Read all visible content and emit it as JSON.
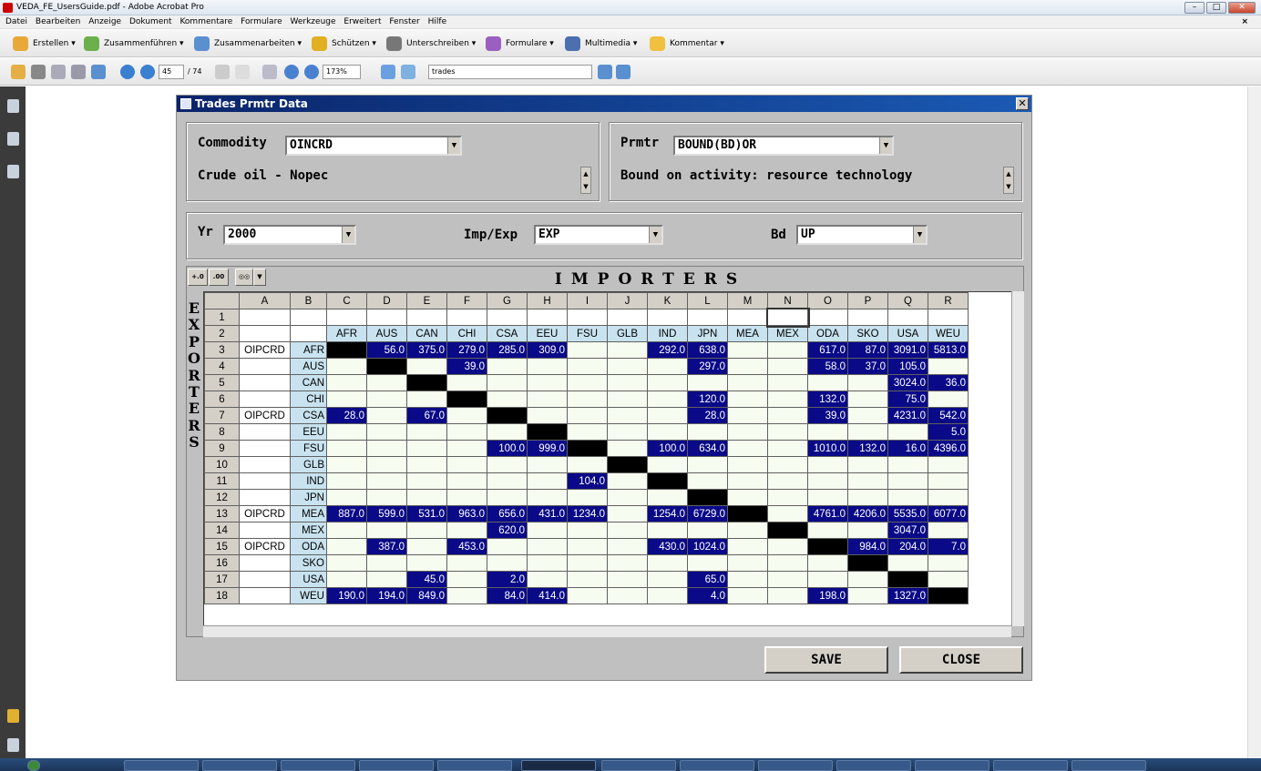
{
  "window": {
    "title": "VEDA_FE_UsersGuide.pdf - Adobe Acrobat Pro"
  },
  "menu": [
    "Datei",
    "Bearbeiten",
    "Anzeige",
    "Dokument",
    "Kommentare",
    "Formulare",
    "Werkzeuge",
    "Erweitert",
    "Fenster",
    "Hilfe"
  ],
  "toolbar1": [
    "Erstellen ▾",
    "Zusammenführen ▾",
    "Zusammenarbeiten ▾",
    "Schützen ▾",
    "Unterschreiben ▾",
    "Formulare ▾",
    "Multimedia ▾",
    "Kommentar ▾"
  ],
  "toolbar2": {
    "page": "45",
    "total": "/ 74",
    "zoom": "173%",
    "search": "trades"
  },
  "dialog": {
    "title": "Trades Prmtr Data",
    "commodity_label": "Commodity",
    "commodity_value": "OINCRD",
    "commodity_desc": "Crude oil - Nopec",
    "prmtr_label": "Prmtr",
    "prmtr_value": "BOUND(BD)OR",
    "prmtr_desc": "Bound on activity: resource technology",
    "yr_label": "Yr",
    "yr_value": "2000",
    "impexp_label": "Imp/Exp",
    "impexp_value": "EXP",
    "bd_label": "Bd",
    "bd_value": "UP",
    "importers_title": "IMPORTERS",
    "exporters_title": "EXPORTERS",
    "save_label": "SAVE",
    "close_label": "CLOSE"
  },
  "grid": {
    "col_letters": [
      "A",
      "B",
      "C",
      "D",
      "E",
      "F",
      "G",
      "H",
      "I",
      "J",
      "K",
      "L",
      "M",
      "N",
      "O",
      "P",
      "Q",
      "R"
    ],
    "regions": [
      "AFR",
      "AUS",
      "CAN",
      "CHI",
      "CSA",
      "EEU",
      "FSU",
      "GLB",
      "IND",
      "JPN",
      "MEA",
      "MEX",
      "ODA",
      "SKO",
      "USA",
      "WEU"
    ],
    "rows": [
      {
        "a": "OIPCRD",
        "b": "AFR",
        "vals": [
          "",
          "56.0",
          "375.0",
          "279.0",
          "285.0",
          "309.0",
          "",
          "",
          "292.0",
          "638.0",
          "",
          "",
          "617.0",
          "87.0",
          "3091.0",
          "5813.0"
        ]
      },
      {
        "a": "",
        "b": "AUS",
        "vals": [
          "",
          "",
          "",
          "39.0",
          "",
          "",
          "",
          "",
          "",
          "297.0",
          "",
          "",
          "58.0",
          "37.0",
          "105.0",
          ""
        ]
      },
      {
        "a": "",
        "b": "CAN",
        "vals": [
          "",
          "",
          "",
          "",
          "",
          "",
          "",
          "",
          "",
          "",
          "",
          "",
          "",
          "",
          "3024.0",
          "36.0"
        ]
      },
      {
        "a": "",
        "b": "CHI",
        "vals": [
          "",
          "",
          "",
          "",
          "",
          "",
          "",
          "",
          "",
          "120.0",
          "",
          "",
          "132.0",
          "",
          "75.0",
          ""
        ]
      },
      {
        "a": "OIPCRD",
        "b": "CSA",
        "vals": [
          "28.0",
          "",
          "67.0",
          "",
          "",
          "",
          "",
          "",
          "",
          "28.0",
          "",
          "",
          "39.0",
          "",
          "4231.0",
          "542.0"
        ]
      },
      {
        "a": "",
        "b": "EEU",
        "vals": [
          "",
          "",
          "",
          "",
          "",
          "",
          "",
          "",
          "",
          "",
          "",
          "",
          "",
          "",
          "",
          "5.0"
        ]
      },
      {
        "a": "",
        "b": "FSU",
        "vals": [
          "",
          "",
          "",
          "",
          "100.0",
          "999.0",
          "",
          "",
          "100.0",
          "634.0",
          "",
          "",
          "1010.0",
          "132.0",
          "16.0",
          "4396.0"
        ]
      },
      {
        "a": "",
        "b": "GLB",
        "vals": [
          "",
          "",
          "",
          "",
          "",
          "",
          "",
          "",
          "",
          "",
          "",
          "",
          "",
          "",
          "",
          ""
        ]
      },
      {
        "a": "",
        "b": "IND",
        "vals": [
          "",
          "",
          "",
          "",
          "",
          "",
          "104.0",
          "",
          "",
          "",
          "",
          "",
          "",
          "",
          "",
          ""
        ]
      },
      {
        "a": "",
        "b": "JPN",
        "vals": [
          "",
          "",
          "",
          "",
          "",
          "",
          "",
          "",
          "",
          "",
          "",
          "",
          "",
          "",
          "",
          ""
        ]
      },
      {
        "a": "OIPCRD",
        "b": "MEA",
        "vals": [
          "887.0",
          "599.0",
          "531.0",
          "963.0",
          "656.0",
          "431.0",
          "1234.0",
          "",
          "1254.0",
          "6729.0",
          "",
          "",
          "4761.0",
          "4206.0",
          "5535.0",
          "6077.0"
        ]
      },
      {
        "a": "",
        "b": "MEX",
        "vals": [
          "",
          "",
          "",
          "",
          "620.0",
          "",
          "",
          "",
          "",
          "",
          "",
          "",
          "",
          "",
          "3047.0",
          ""
        ]
      },
      {
        "a": "OIPCRD",
        "b": "ODA",
        "vals": [
          "",
          "387.0",
          "",
          "453.0",
          "",
          "",
          "",
          "",
          "430.0",
          "1024.0",
          "",
          "",
          "",
          "984.0",
          "204.0",
          "7.0"
        ]
      },
      {
        "a": "",
        "b": "SKO",
        "vals": [
          "",
          "",
          "",
          "",
          "",
          "",
          "",
          "",
          "",
          "",
          "",
          "",
          "",
          "",
          "",
          ""
        ]
      },
      {
        "a": "",
        "b": "USA",
        "vals": [
          "",
          "",
          "45.0",
          "",
          "2.0",
          "",
          "",
          "",
          "",
          "65.0",
          "",
          "",
          "",
          "",
          "",
          ""
        ]
      },
      {
        "a": "",
        "b": "WEU",
        "vals": [
          "190.0",
          "194.0",
          "849.0",
          "",
          "84.0",
          "414.0",
          "",
          "",
          "",
          "4.0",
          "",
          "",
          "198.0",
          "",
          "1327.0",
          ""
        ]
      }
    ]
  }
}
